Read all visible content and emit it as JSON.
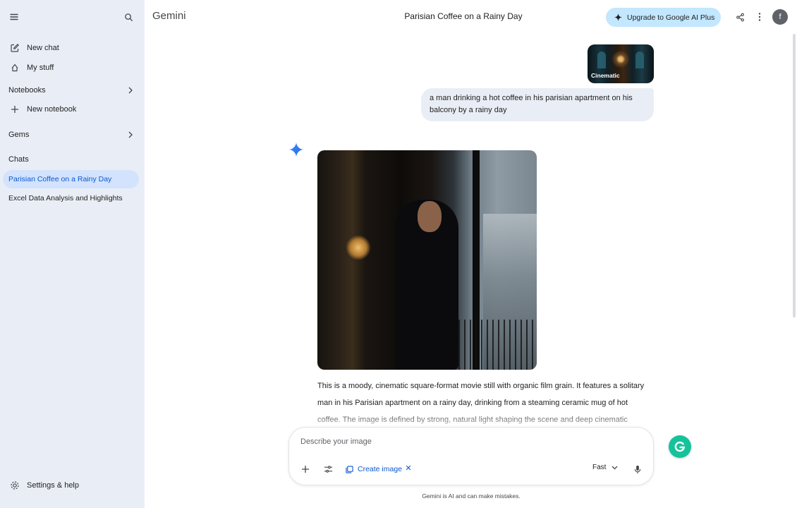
{
  "sidebar": {
    "new_chat": "New chat",
    "my_stuff": "My stuff",
    "notebooks": "Notebooks",
    "new_notebook": "New notebook",
    "gems": "Gems",
    "chats_heading": "Chats",
    "chats": [
      {
        "label": "Parisian Coffee on a Rainy Day",
        "active": true
      },
      {
        "label": "Excel Data Analysis and Highlights",
        "active": false
      }
    ],
    "settings": "Settings & help"
  },
  "header": {
    "brand": "Gemini",
    "chat_title": "Parisian Coffee on a Rainy Day",
    "upgrade_label": "Upgrade to Google AI Plus",
    "avatar_initial": "f"
  },
  "conversation": {
    "style_thumbnail_label": "Cinematic",
    "user_prompt": "a man drinking a hot coffee in his parisian apartment on his balcony by a rainy day",
    "response_text": "This is a moody, cinematic square-format movie still with organic film grain. It features a solitary man in his Parisian apartment on a rainy day, drinking from a steaming ceramic mug of hot coffee. The image is defined by strong, natural light shaping the scene and deep cinematic"
  },
  "prompt": {
    "placeholder": "Describe your image",
    "tool_chip": "Create image",
    "mode": "Fast"
  },
  "footer": {
    "disclaimer": "Gemini is AI and can make mistakes."
  },
  "colors": {
    "sidebar_bg": "#e9eef6",
    "active_chat_bg": "#d3e3fd",
    "accent_blue": "#0b57d0",
    "upgrade_bg": "#c2e7ff",
    "grammarly_green": "#15c39a"
  }
}
